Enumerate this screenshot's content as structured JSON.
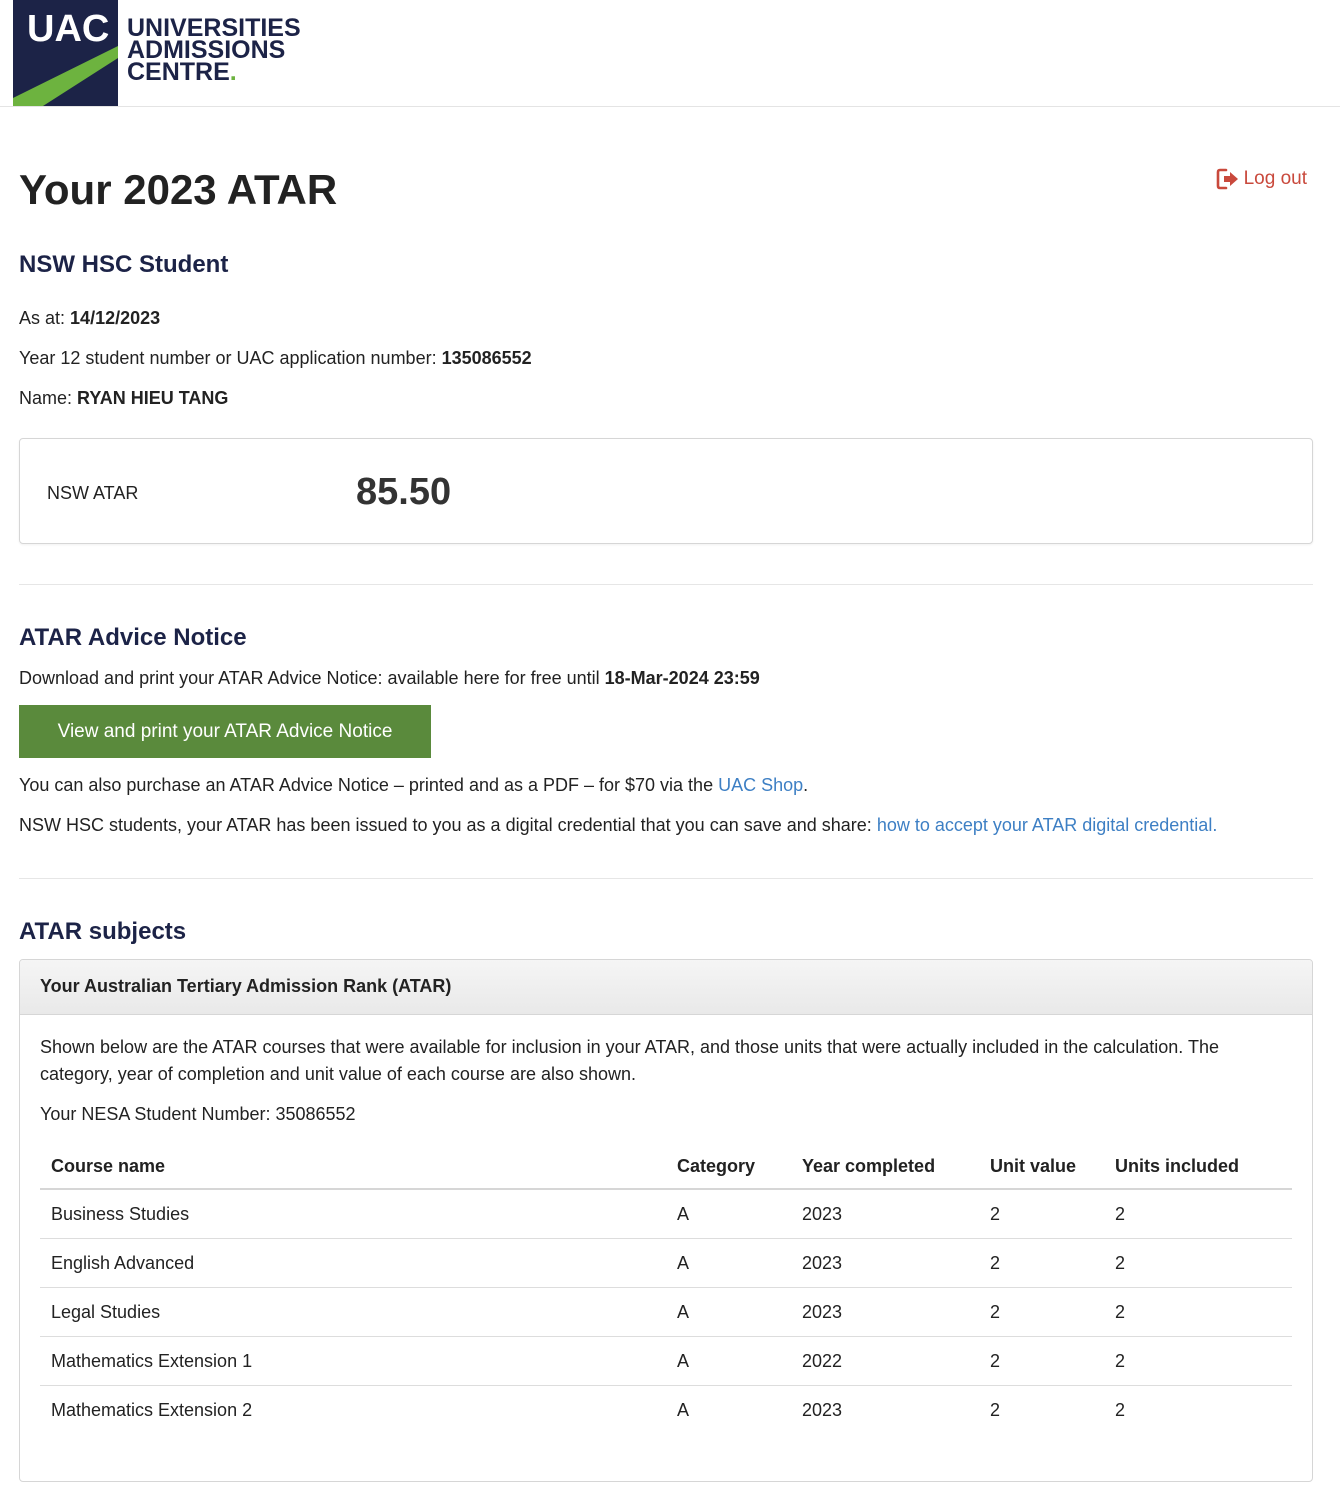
{
  "brand": {
    "abbr": "UAC",
    "line1": "UNIVERSITIES",
    "line2": "ADMISSIONS",
    "line3": "CENTRE",
    "dot": ".",
    "navy": "#1c2347",
    "green": "#6db33f"
  },
  "page": {
    "title": "Your 2023 ATAR",
    "logout_label": "Log out",
    "logout_icon": "sign-out-icon"
  },
  "student": {
    "heading": "NSW HSC Student",
    "as_at_label": "As at:",
    "as_at_value": "14/12/2023",
    "number_label": "Year 12 student number or UAC application number:",
    "number_value": "135086552",
    "name_label": "Name:",
    "name_value": "RYAN HIEU TANG"
  },
  "atar": {
    "label": "NSW ATAR",
    "value": "85.50"
  },
  "advice": {
    "heading": "ATAR Advice Notice",
    "download_text": "Download and print your ATAR Advice Notice: available here for free until",
    "download_deadline": "18-Mar-2024 23:59",
    "button_label": "View and print your ATAR Advice Notice",
    "purchase_text": "You can also purchase an ATAR Advice Notice – printed and as a PDF – for $70 via the",
    "shop_link": "UAC Shop",
    "purchase_end": ".",
    "credential_text": "NSW HSC students, your ATAR has been issued to you as a digital credential that you can save and share:",
    "credential_link": "how to accept your ATAR digital credential."
  },
  "subjects": {
    "heading": "ATAR subjects",
    "panel_title": "Your Australian Tertiary Admission Rank (ATAR)",
    "description": "Shown below are the ATAR courses that were available for inclusion in your ATAR, and those units that were actually included in the calculation. The category, year of completion and unit value of each course are also shown.",
    "nesa_label": "Your NESA Student Number: 35086552",
    "columns": [
      "Course name",
      "Category",
      "Year completed",
      "Unit value",
      "Units included"
    ],
    "rows": [
      [
        "Business Studies",
        "A",
        "2023",
        "2",
        "2"
      ],
      [
        "English Advanced",
        "A",
        "2023",
        "2",
        "2"
      ],
      [
        "Legal Studies",
        "A",
        "2023",
        "2",
        "2"
      ],
      [
        "Mathematics Extension 1",
        "A",
        "2022",
        "2",
        "2"
      ],
      [
        "Mathematics Extension 2",
        "A",
        "2023",
        "2",
        "2"
      ]
    ]
  }
}
